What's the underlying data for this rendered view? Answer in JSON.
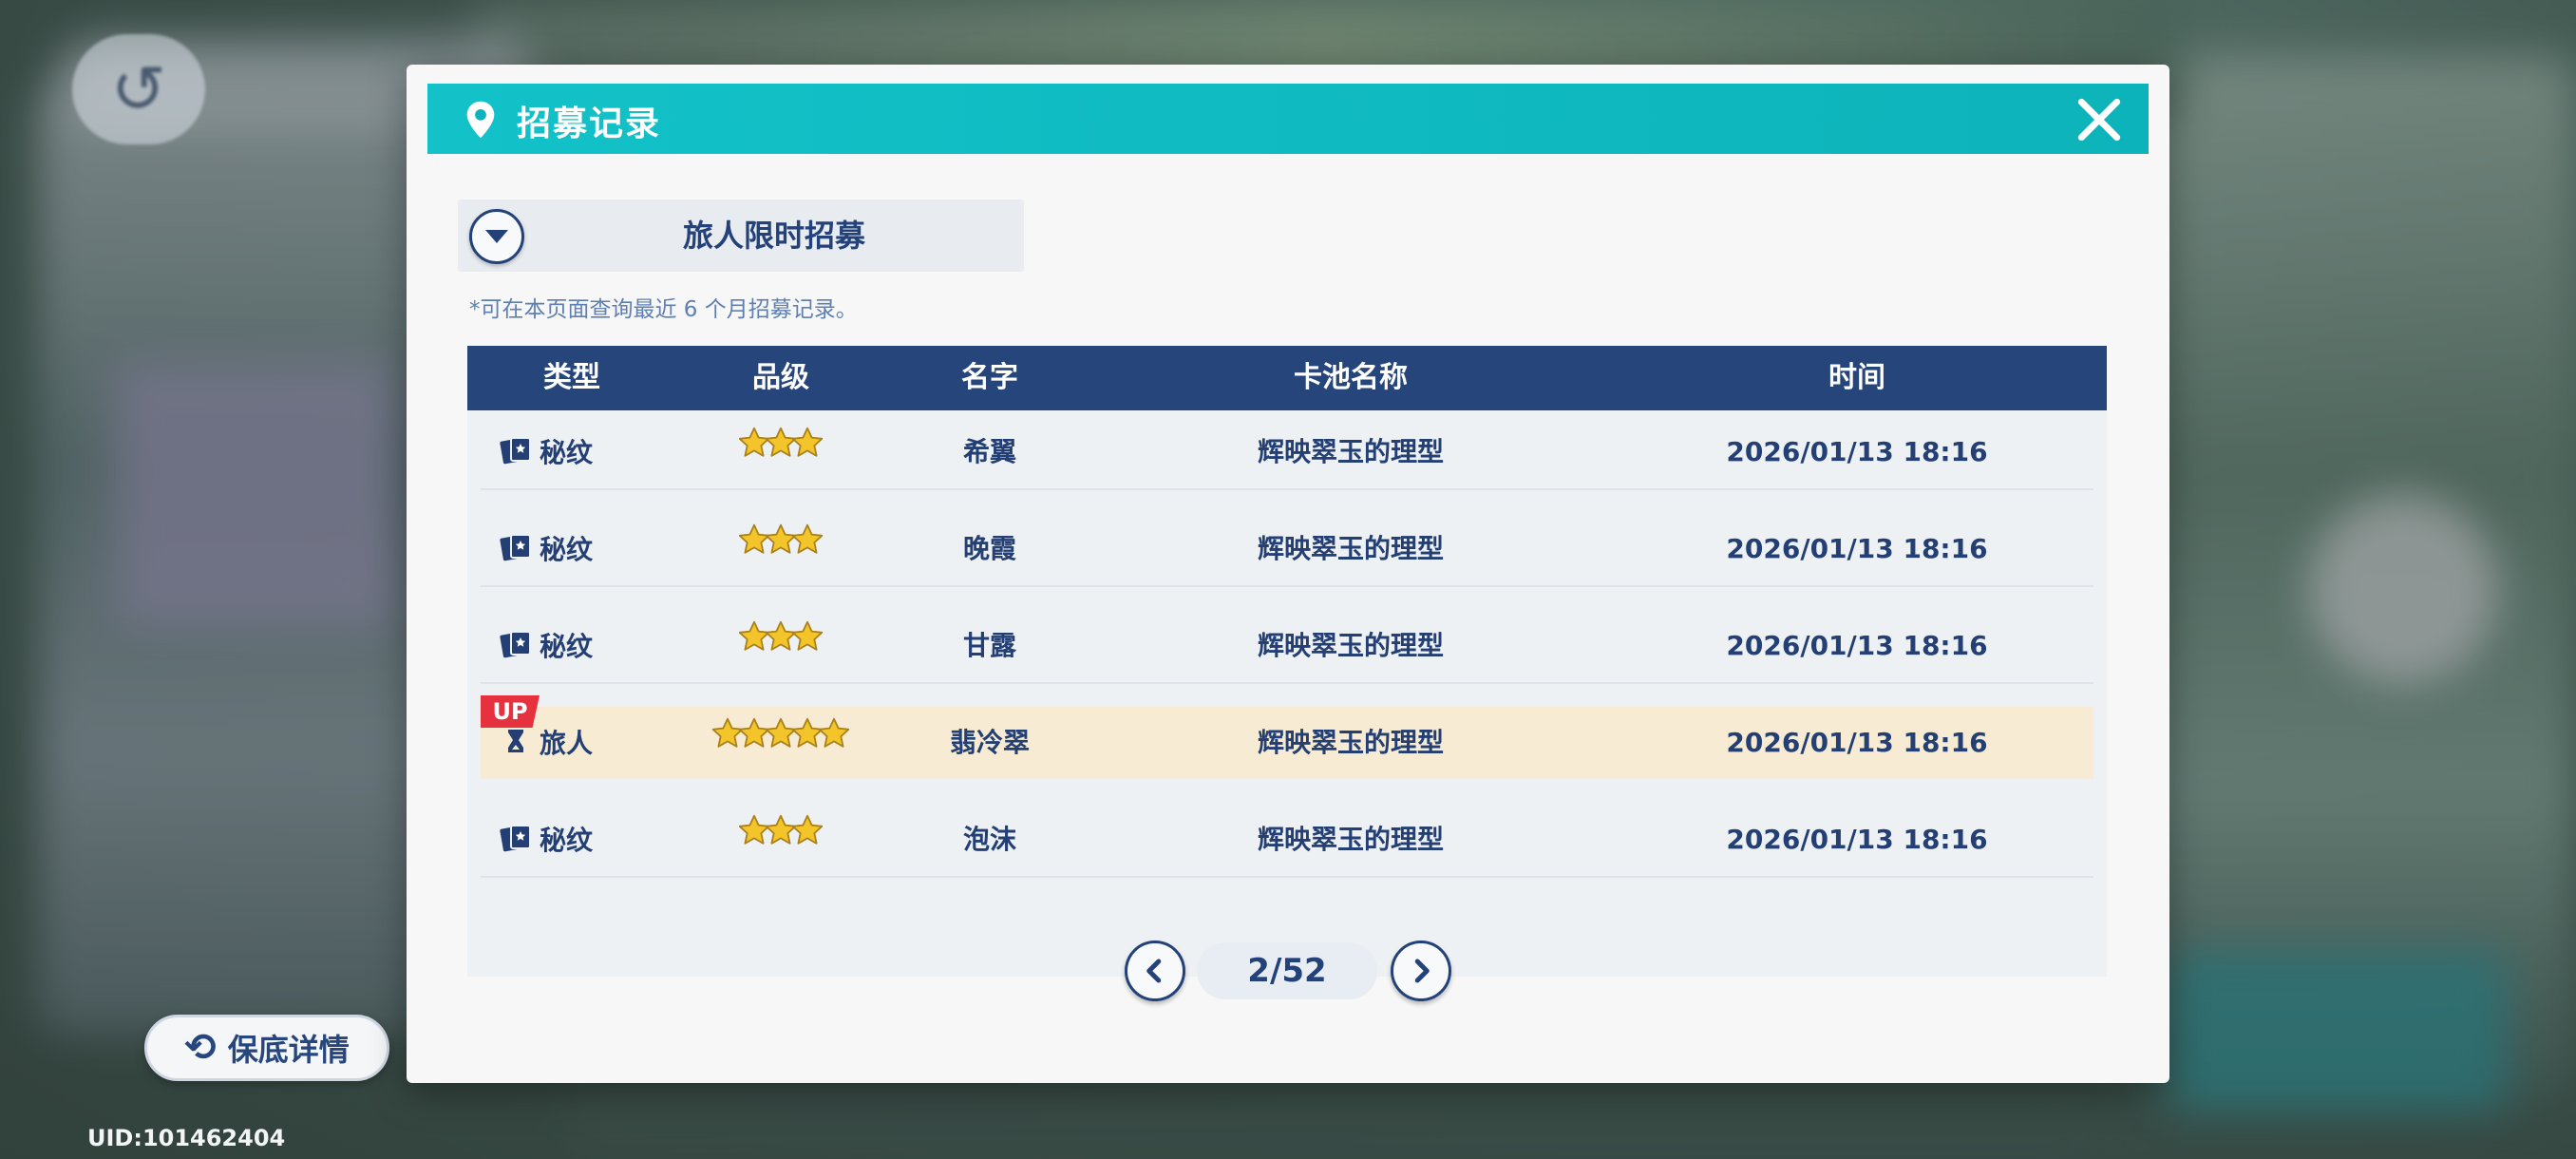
{
  "dialog": {
    "title": "招募记录",
    "pool_selector": "旅人限时招募",
    "notice": "*可在本页面查询最近 6 个月招募记录。"
  },
  "table": {
    "headers": {
      "type": "类型",
      "rank": "品级",
      "name": "名字",
      "pool": "卡池名称",
      "time": "时间"
    },
    "rows": [
      {
        "type": "秘纹",
        "type_icon": "card-icon",
        "stars": 3,
        "name": "希翼",
        "pool": "辉映翠玉的理型",
        "time": "2026/01/13 18:16",
        "up": ""
      },
      {
        "type": "秘纹",
        "type_icon": "card-icon",
        "stars": 3,
        "name": "晚霞",
        "pool": "辉映翠玉的理型",
        "time": "2026/01/13 18:16",
        "up": ""
      },
      {
        "type": "秘纹",
        "type_icon": "card-icon",
        "stars": 3,
        "name": "甘露",
        "pool": "辉映翠玉的理型",
        "time": "2026/01/13 18:16",
        "up": ""
      },
      {
        "type": "旅人",
        "type_icon": "traveler-icon",
        "stars": 5,
        "name": "翡冷翠",
        "pool": "辉映翠玉的理型",
        "time": "2026/01/13 18:16",
        "up": "UP"
      },
      {
        "type": "秘纹",
        "type_icon": "card-icon",
        "stars": 3,
        "name": "泡沫",
        "pool": "辉映翠玉的理型",
        "time": "2026/01/13 18:16",
        "up": ""
      }
    ]
  },
  "pagination": {
    "indicator": "2/52"
  },
  "guarantee_button": {
    "label": "保底详情"
  },
  "uid": "UID:101462404",
  "colors": {
    "accent": "#0db3ba",
    "navy": "#26457a",
    "highlight_row": "#f7ecd3",
    "up_badge": "#e6313f",
    "star": "#f4c52a"
  }
}
